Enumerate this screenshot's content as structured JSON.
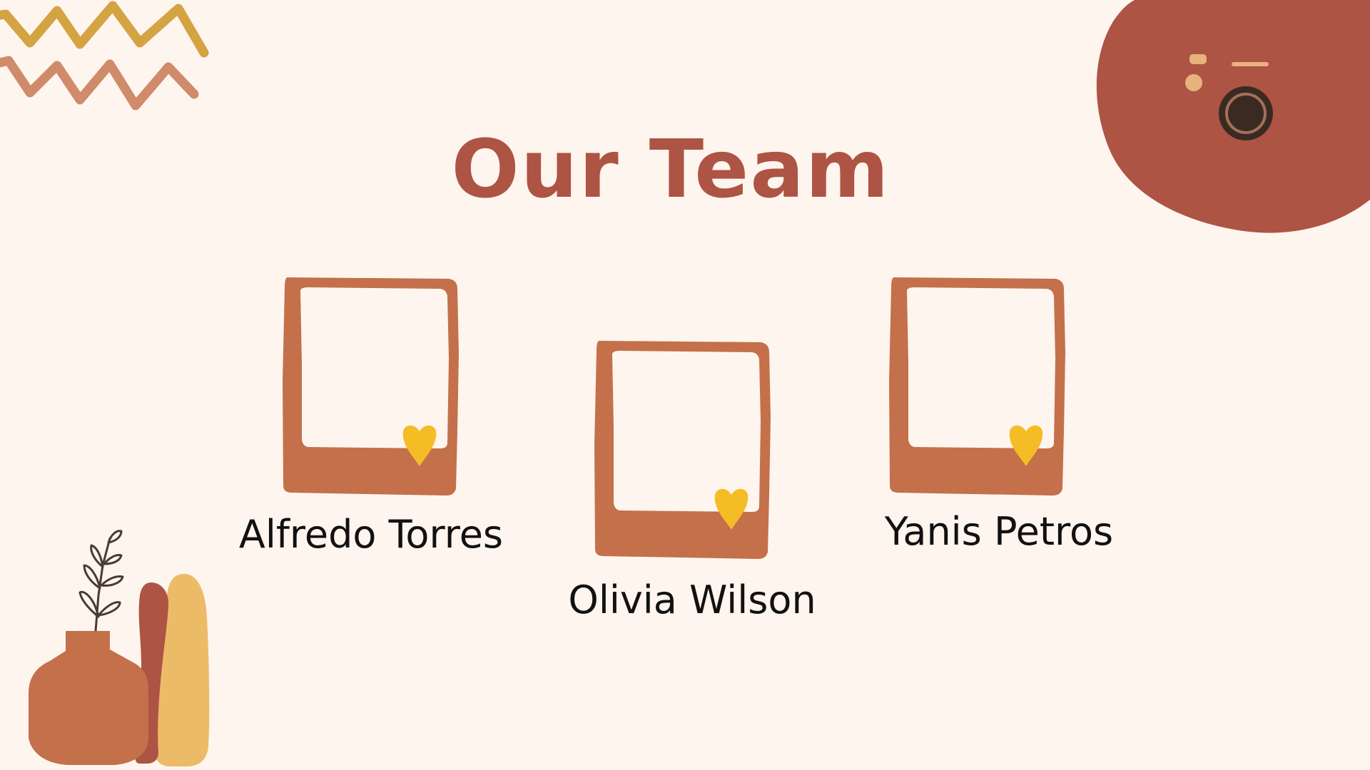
{
  "slide": {
    "title": "Our Team",
    "members": [
      {
        "name": "Alfredo Torres"
      },
      {
        "name": "Olivia Wilson"
      },
      {
        "name": "Yanis Petros"
      }
    ]
  },
  "colors": {
    "background": "#fef5ee",
    "title": "#ad5444",
    "frame": "#c4704b",
    "heart": "#f5bc25",
    "zigzag_gold": "#d4a342",
    "zigzag_tan": "#cf8b6a",
    "camera_blob": "#ad5444",
    "vase": "#c4704b",
    "vase_red": "#ad5444",
    "vase_yellow": "#ecbb68",
    "text": "#111111"
  },
  "icons": {
    "frames": "photo-frame-icon",
    "hearts": "heart-icon",
    "camera": "camera-icon",
    "plant": "plant-vase-icon",
    "zigzag": "zigzag-decoration-icon"
  }
}
